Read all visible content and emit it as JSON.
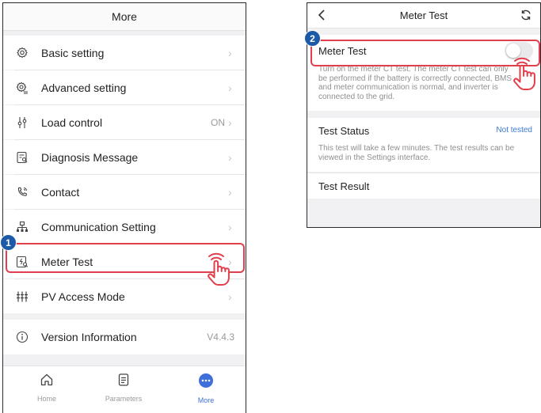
{
  "left_screen": {
    "title": "More",
    "items": [
      {
        "label": "Basic setting",
        "icon": "gear-icon",
        "value": ""
      },
      {
        "label": "Advanced setting",
        "icon": "gear-list-icon",
        "value": ""
      },
      {
        "label": "Load control",
        "icon": "sliders-icon",
        "value": "ON"
      },
      {
        "label": "Diagnosis Message",
        "icon": "diagnosis-icon",
        "value": ""
      },
      {
        "label": "Contact",
        "icon": "phone-icon",
        "value": ""
      },
      {
        "label": "Communication Setting",
        "icon": "network-icon",
        "value": ""
      },
      {
        "label": "Meter Test",
        "icon": "meter-test-icon",
        "value": ""
      },
      {
        "label": "PV Access Mode",
        "icon": "pv-mode-icon",
        "value": ""
      }
    ],
    "version": {
      "label": "Version Information",
      "value": "V4.4.3",
      "icon": "info-icon"
    },
    "tabs": [
      {
        "label": "Home",
        "icon": "home-icon"
      },
      {
        "label": "Parameters",
        "icon": "document-icon"
      },
      {
        "label": "More",
        "icon": "more-icon"
      }
    ],
    "step_badge": "1"
  },
  "right_screen": {
    "title": "Meter Test",
    "back_icon": "chevron-left-icon",
    "refresh_icon": "refresh-icon",
    "meter_test_label": "Meter Test",
    "meter_test_note": "Turn on the meter CT test. The meter CT test can only be performed if the battery is correctly connected, BMS and meter communication is normal, and inverter is connected to the grid.",
    "test_status_label": "Test Status",
    "test_status_value": "Not tested",
    "test_status_note": "This test will take a few minutes. The test results can be viewed in the Settings interface.",
    "test_result_label": "Test Result",
    "step_badge": "2",
    "toggle_on": false
  },
  "colors": {
    "highlight": "#e23f4c",
    "badge": "#1c5aa9",
    "accent": "#3f6fd8",
    "status_blue": "#3b7ad9"
  }
}
